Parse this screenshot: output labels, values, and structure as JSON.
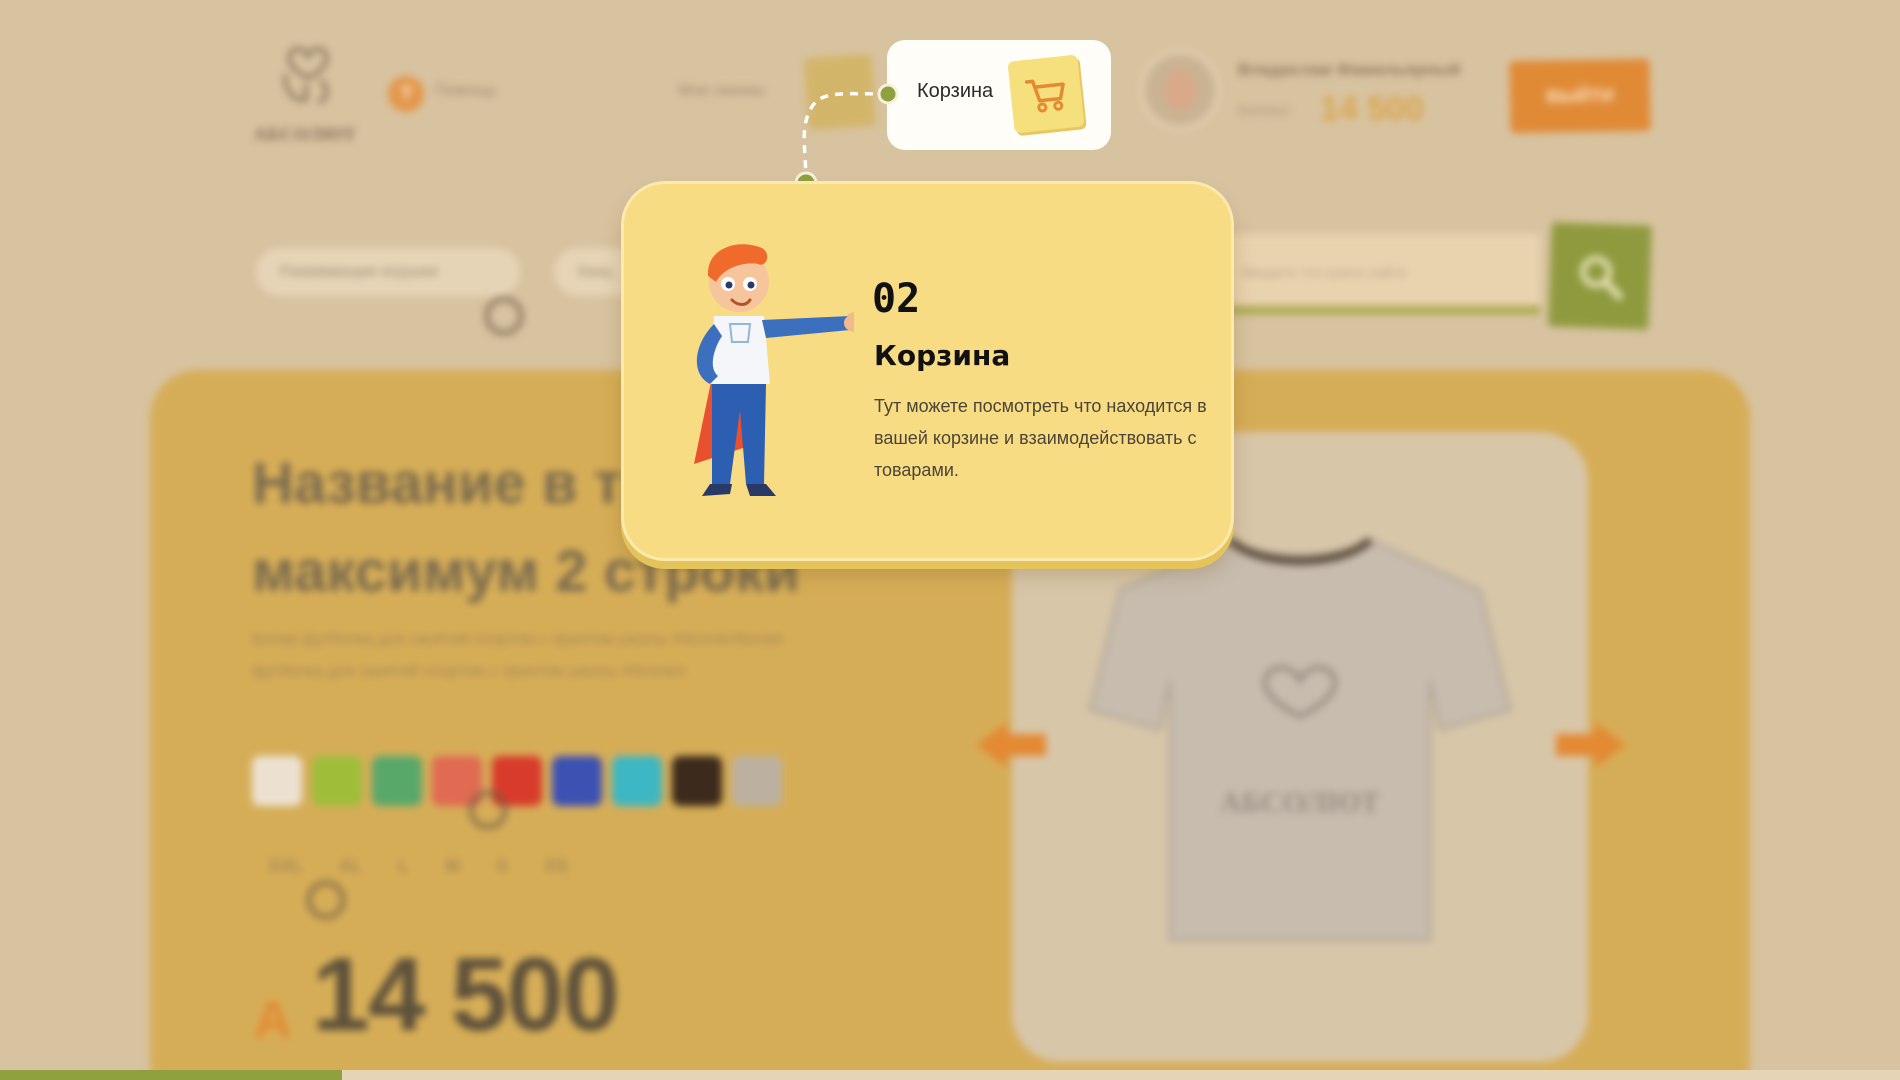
{
  "colors": {
    "page_bg": "#d8c3a0",
    "accent_orange": "#e38a33",
    "accent_green": "#8ea13e",
    "tooltip_bg": "#f8dc84"
  },
  "header": {
    "logo_text": "АБСОЛЮТ",
    "help_label": "Помощь",
    "orders_label": "Мои заказы",
    "user_name": "Владислав Фамильярный",
    "balance_label": "Баланс:",
    "balance_value": "14 500",
    "logout_label": "ВЫЙТИ",
    "cart_label": "Корзина"
  },
  "nav": {
    "pill_1": "Развивающие игрушки",
    "pill_2": "Канц"
  },
  "search": {
    "placeholder": "Введите что нужно найти"
  },
  "product": {
    "title": "Название в три и максимум 2 строки",
    "description": "Белая футболка для занятий спортом с принтом школы АбсолютБелая футболка для занятий спортом с принтом школы Абсолют",
    "swatch_colors": [
      "#ece1d1",
      "#9ebe3a",
      "#58a86a",
      "#e06a52",
      "#d83b2b",
      "#3d51b3",
      "#3cb7c3",
      "#3c2a1c",
      "#bcb1a1"
    ],
    "sizes": [
      "XXL",
      "XL",
      "L",
      "M",
      "S",
      "XS"
    ],
    "currency": "A",
    "price": "14 500",
    "image_logo": "АБСОЛЮТ"
  },
  "tour": {
    "step_number": "02",
    "step_title": "Корзина",
    "step_text": "Тут можете посмотреть что находится в вашей корзине и взаимодействовать с товарами.",
    "progress": 0.18
  }
}
